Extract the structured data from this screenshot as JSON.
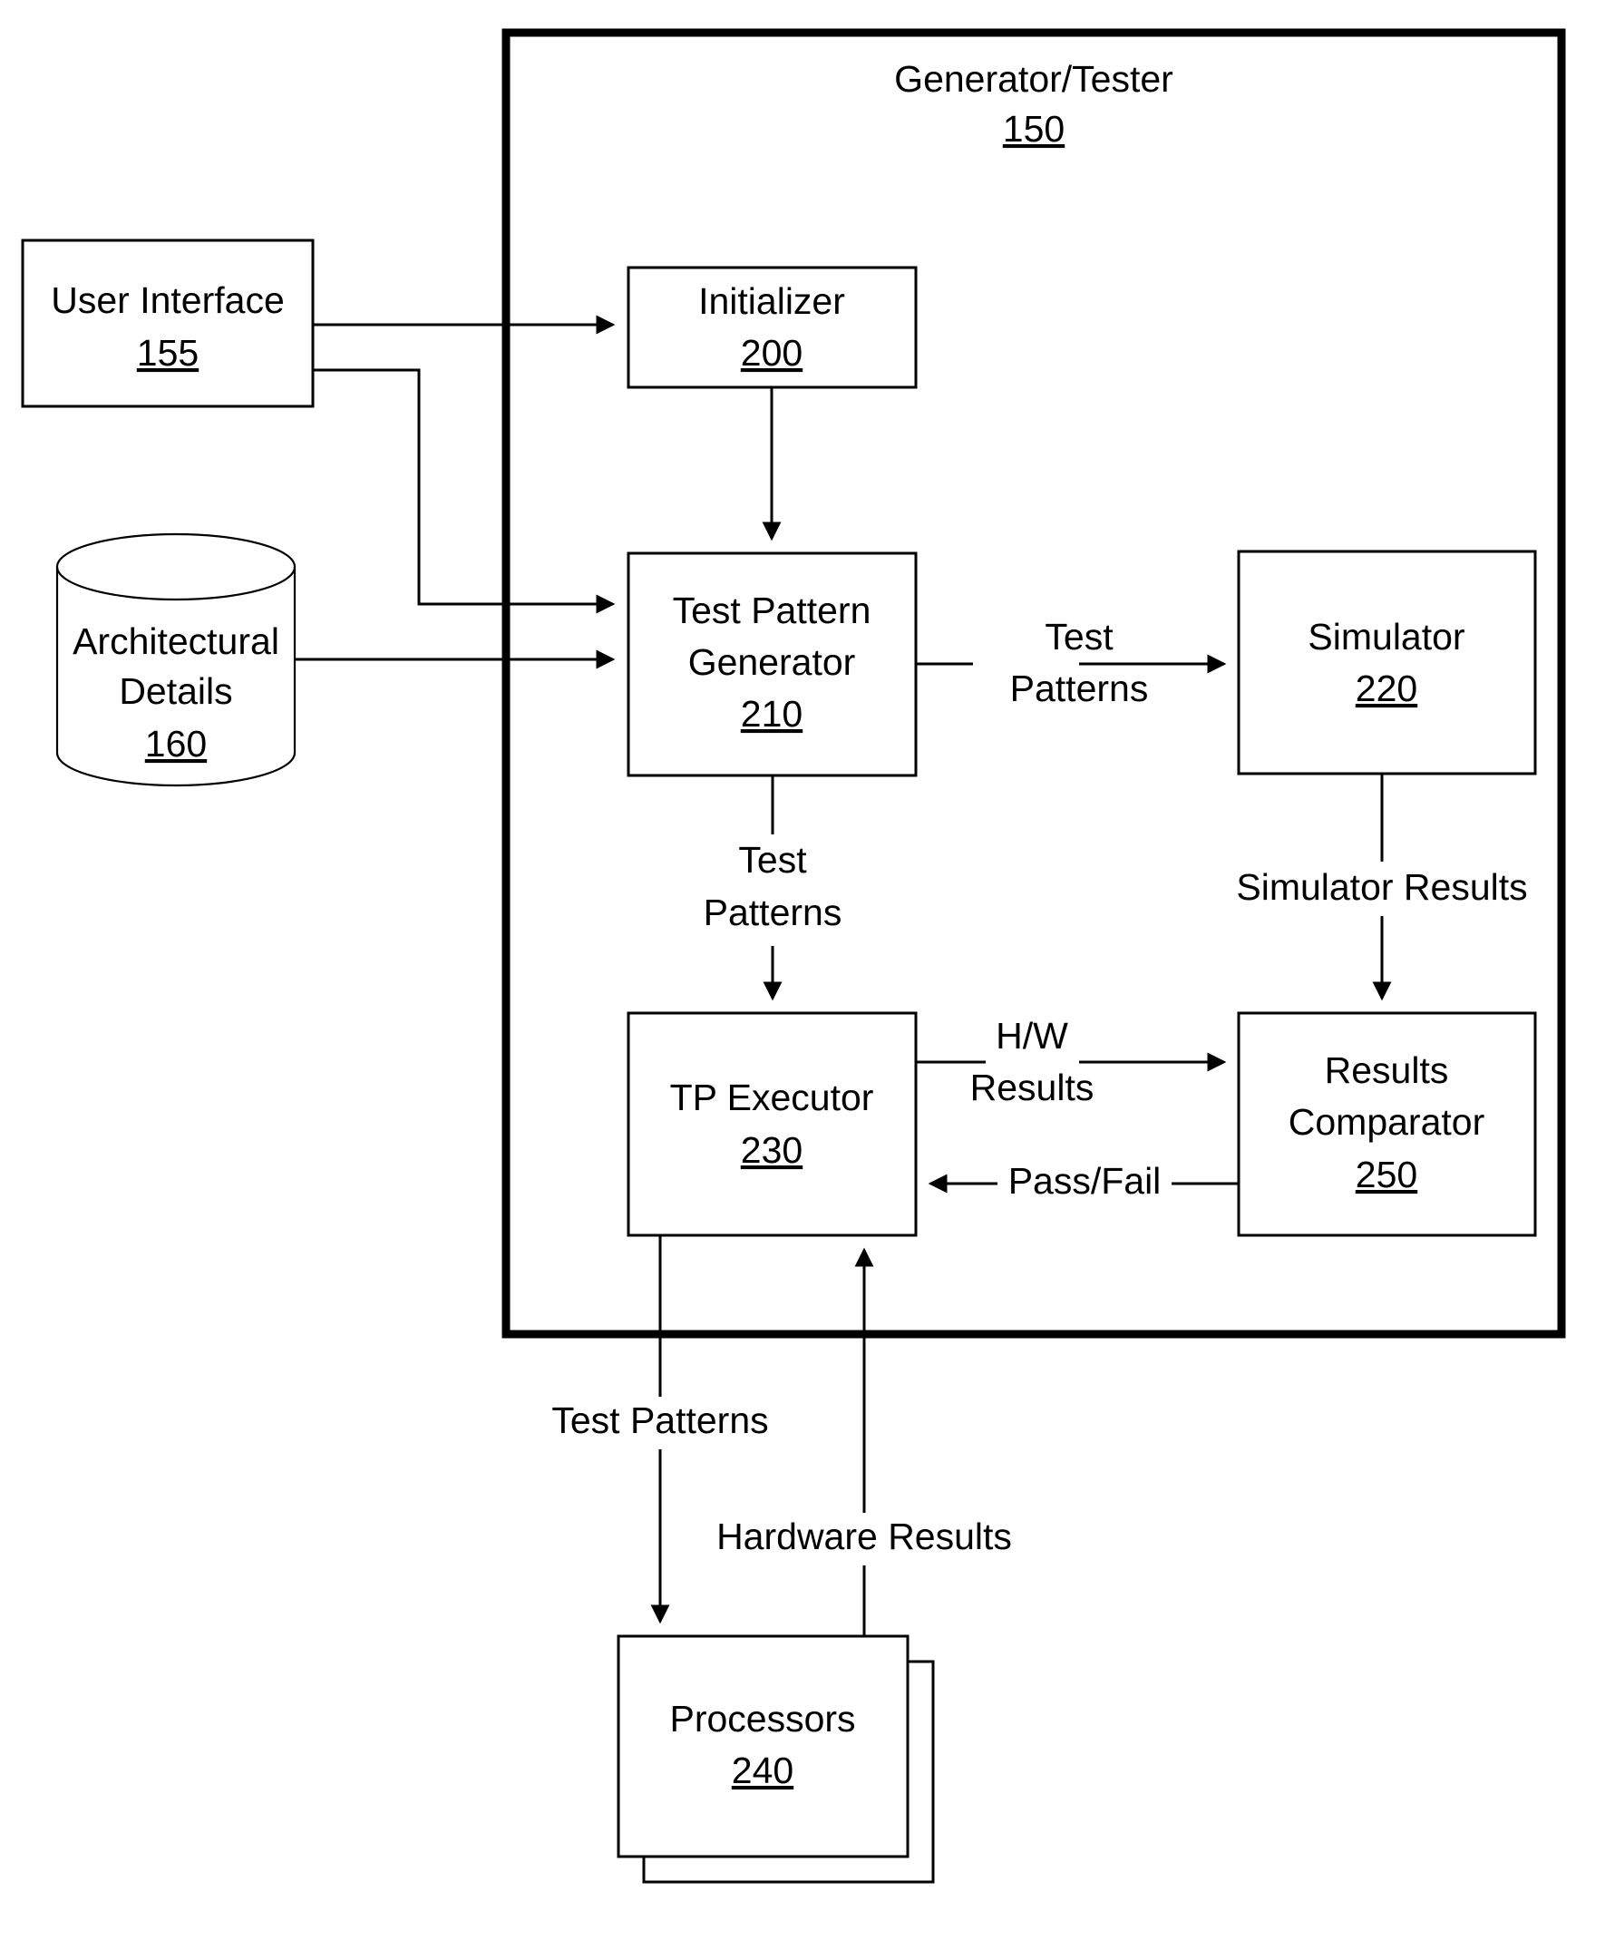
{
  "figure": {
    "type": "block-diagram",
    "background": "#ffffff",
    "line_color": "#000000"
  },
  "outer_container": {
    "title": "Generator/Tester",
    "ref": "150"
  },
  "blocks": [
    {
      "id": "user_interface",
      "label_line1": "User Interface",
      "label_line2": "",
      "ref": "155",
      "shape": "rect"
    },
    {
      "id": "architectural",
      "label_line1": "Architectural",
      "label_line2": "Details",
      "ref": "160",
      "shape": "cylinder"
    },
    {
      "id": "initializer",
      "label_line1": "Initializer",
      "label_line2": "",
      "ref": "200",
      "shape": "rect"
    },
    {
      "id": "test_pattern_gen",
      "label_line1": "Test Pattern",
      "label_line2": "Generator",
      "ref": "210",
      "shape": "rect"
    },
    {
      "id": "simulator",
      "label_line1": "Simulator",
      "label_line2": "",
      "ref": "220",
      "shape": "rect"
    },
    {
      "id": "tp_executor",
      "label_line1": "TP Executor",
      "label_line2": "",
      "ref": "230",
      "shape": "rect"
    },
    {
      "id": "results_comparator",
      "label_line1": "Results",
      "label_line2": "Comparator",
      "ref": "250",
      "shape": "rect"
    },
    {
      "id": "processors",
      "label_line1": "Processors",
      "label_line2": "",
      "ref": "240",
      "shape": "stacked-rect"
    }
  ],
  "edge_labels": {
    "tpg_to_simulator_l1": "Test",
    "tpg_to_simulator_l2": "Patterns",
    "tpg_to_executor_l1": "Test",
    "tpg_to_executor_l2": "Patterns",
    "simulator_to_comparator": "Simulator Results",
    "executor_to_comparator_l1": "H/W",
    "executor_to_comparator_l2": "Results",
    "comparator_to_executor": "Pass/Fail",
    "executor_to_processors": "Test Patterns",
    "processors_to_executor": "Hardware Results"
  }
}
